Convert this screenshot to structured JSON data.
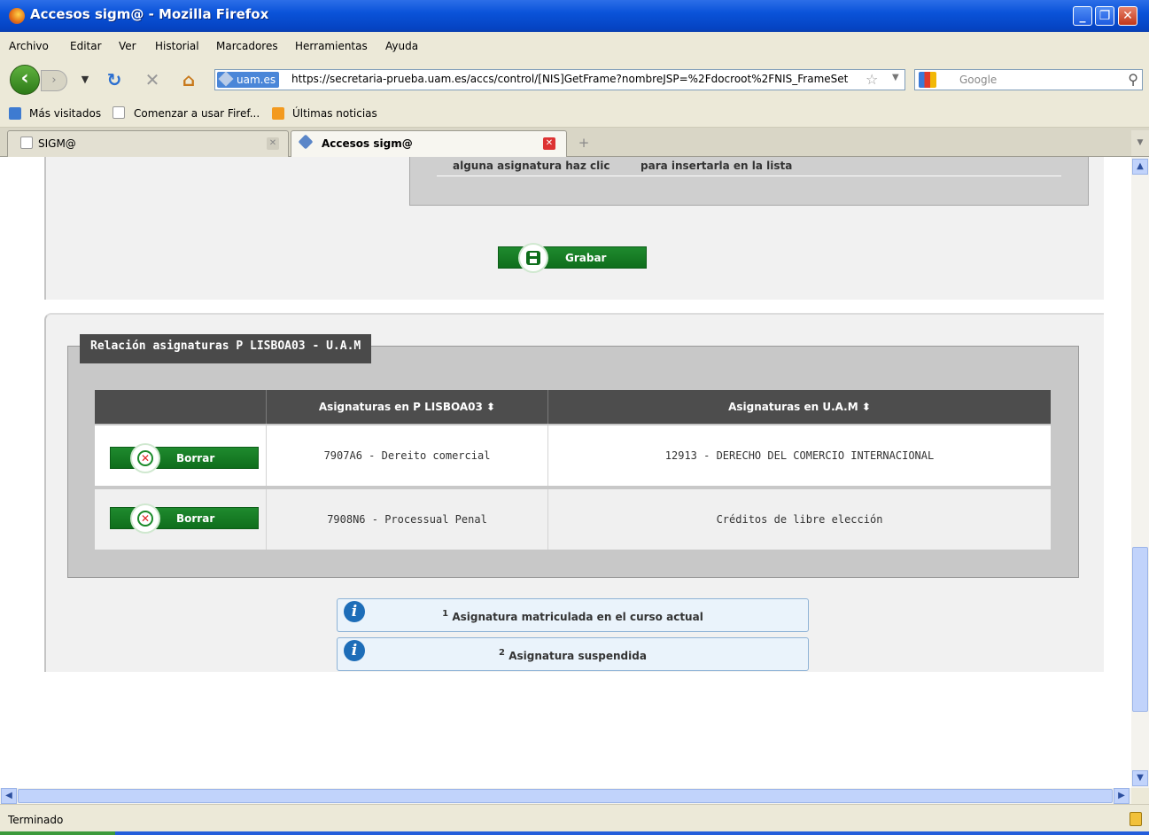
{
  "window": {
    "title": "Accesos sigm@ - Mozilla Firefox",
    "controls": [
      "minimize",
      "maximize",
      "close"
    ]
  },
  "menu": [
    "Archivo",
    "Editar",
    "Ver",
    "Historial",
    "Marcadores",
    "Herramientas",
    "Ayuda"
  ],
  "navbar": {
    "site_badge": "uam.es",
    "url": "https://secretaria-prueba.uam.es/accs/control/[NIS]GetFrame?nombreJSP=%2Fdocroot%2FNIS_FrameSet",
    "search_placeholder": "Google"
  },
  "bookmarks": [
    "Más visitados",
    "Comenzar a usar Firef...",
    "Últimas noticias"
  ],
  "tabs": [
    {
      "label": "SIGM@",
      "active": false
    },
    {
      "label": "Accesos sigm@",
      "active": true
    }
  ],
  "page": {
    "upper_box": {
      "text_left": "alguna asignatura haz clic",
      "text_right": "para insertarla en la lista"
    },
    "save_button": "Grabar",
    "fieldset_legend": "Relación asignaturas P LISBOA03 - U.A.M",
    "table": {
      "headers": [
        "",
        "Asignaturas en P LISBOA03 ⬍",
        "Asignaturas en U.A.M ⬍"
      ],
      "delete_label": "Borrar",
      "rows": [
        {
          "origin": "7907A6 - Dereito comercial",
          "target": "12913 - DERECHO DEL COMERCIO INTERNACIONAL"
        },
        {
          "origin": "7908N6 - Processual Penal",
          "target": "Créditos de libre elección"
        }
      ]
    },
    "legend_notes": [
      {
        "sup": "1",
        "text": "Asignatura matriculada en el curso actual"
      },
      {
        "sup": "2",
        "text": "Asignatura suspendida"
      }
    ]
  },
  "status": "Terminado",
  "colors": {
    "titlebar": "#0a53d9",
    "green_button": "#1a7f2a",
    "table_header": "#4d4d4d",
    "info_box": "#eaf3fb"
  }
}
